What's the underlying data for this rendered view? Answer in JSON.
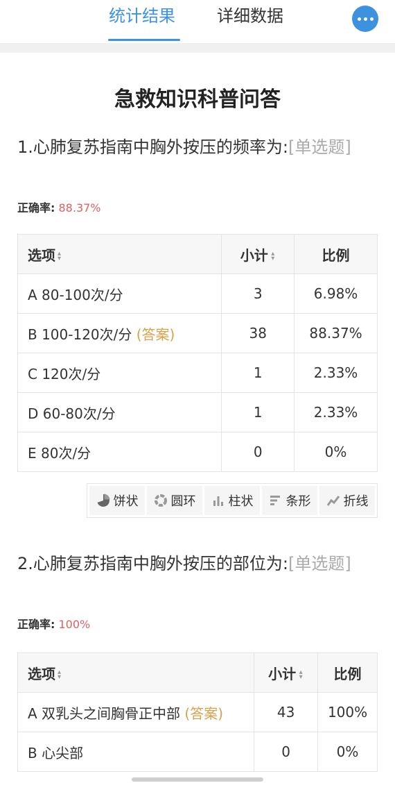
{
  "header": {
    "tab_active": "统计结果",
    "tab_inactive": "详细数据",
    "more_icon": "more-dots-icon",
    "accent_color": "#3d92e0"
  },
  "survey_title": "急救知识科普问答",
  "questions": [
    {
      "title": "1.心肺复苏指南中胸外按压的频率为:",
      "type": "[单选题]",
      "accuracy_label": "正确率:",
      "accuracy_value": "88.37%",
      "columns": [
        "选项",
        "小计",
        "比例"
      ],
      "rows": [
        {
          "option": "A 80-100次/分",
          "answer": "",
          "count": "3",
          "ratio": "6.98%"
        },
        {
          "option": "B 100-120次/分",
          "answer": "(答案)",
          "count": "38",
          "ratio": "88.37%"
        },
        {
          "option": "C 120次/分",
          "answer": "",
          "count": "1",
          "ratio": "2.33%"
        },
        {
          "option": "D 60-80次/分",
          "answer": "",
          "count": "1",
          "ratio": "2.33%"
        },
        {
          "option": "E 80次/分",
          "answer": "",
          "count": "0",
          "ratio": "0%"
        }
      ],
      "chart_buttons": [
        {
          "label": "饼状",
          "icon": "pie-chart-icon"
        },
        {
          "label": "圆环",
          "icon": "ring-chart-icon"
        },
        {
          "label": "柱状",
          "icon": "column-chart-icon"
        },
        {
          "label": "条形",
          "icon": "bar-chart-icon"
        },
        {
          "label": "折线",
          "icon": "line-chart-icon"
        }
      ]
    },
    {
      "title": "2.心肺复苏指南中胸外按压的部位为:",
      "type": "[单选题]",
      "accuracy_label": "正确率:",
      "accuracy_value": "100%",
      "columns": [
        "选项",
        "小计",
        "比例"
      ],
      "rows": [
        {
          "option": "A 双乳头之间胸骨正中部",
          "answer": "(答案)",
          "count": "43",
          "ratio": "100%"
        },
        {
          "option": "B 心尖部",
          "answer": "",
          "count": "0",
          "ratio": "0%"
        }
      ]
    }
  ]
}
